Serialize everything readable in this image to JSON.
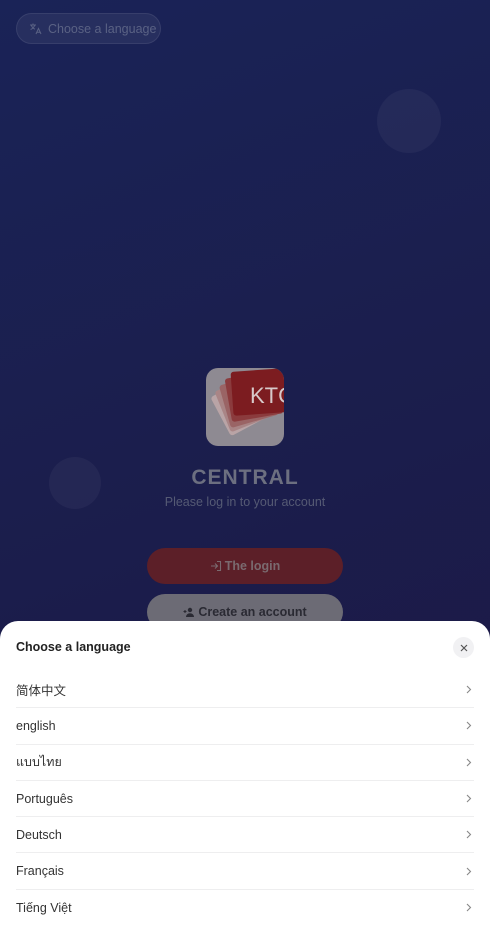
{
  "header": {
    "language_button_label": "Choose a language",
    "language_icon": "translate-icon"
  },
  "brand": {
    "name": "CENTRAL",
    "subtitle": "Please log in to your account",
    "logo_text": "KTC"
  },
  "actions": {
    "login_label": "The login",
    "login_icon": "login-icon",
    "create_label": "Create an account",
    "create_icon": "person-add-icon"
  },
  "language_sheet": {
    "title": "Choose a language",
    "close_icon": "close-icon",
    "languages": [
      {
        "label": "简体中文"
      },
      {
        "label": "english"
      },
      {
        "label": "แบบไทย"
      },
      {
        "label": "Português"
      },
      {
        "label": "Deutsch"
      },
      {
        "label": "Français"
      },
      {
        "label": "Tiếng Việt"
      }
    ]
  },
  "colors": {
    "background": "#1b1e4d",
    "login_button": "#5c1f28",
    "sheet": "#ffffff"
  }
}
